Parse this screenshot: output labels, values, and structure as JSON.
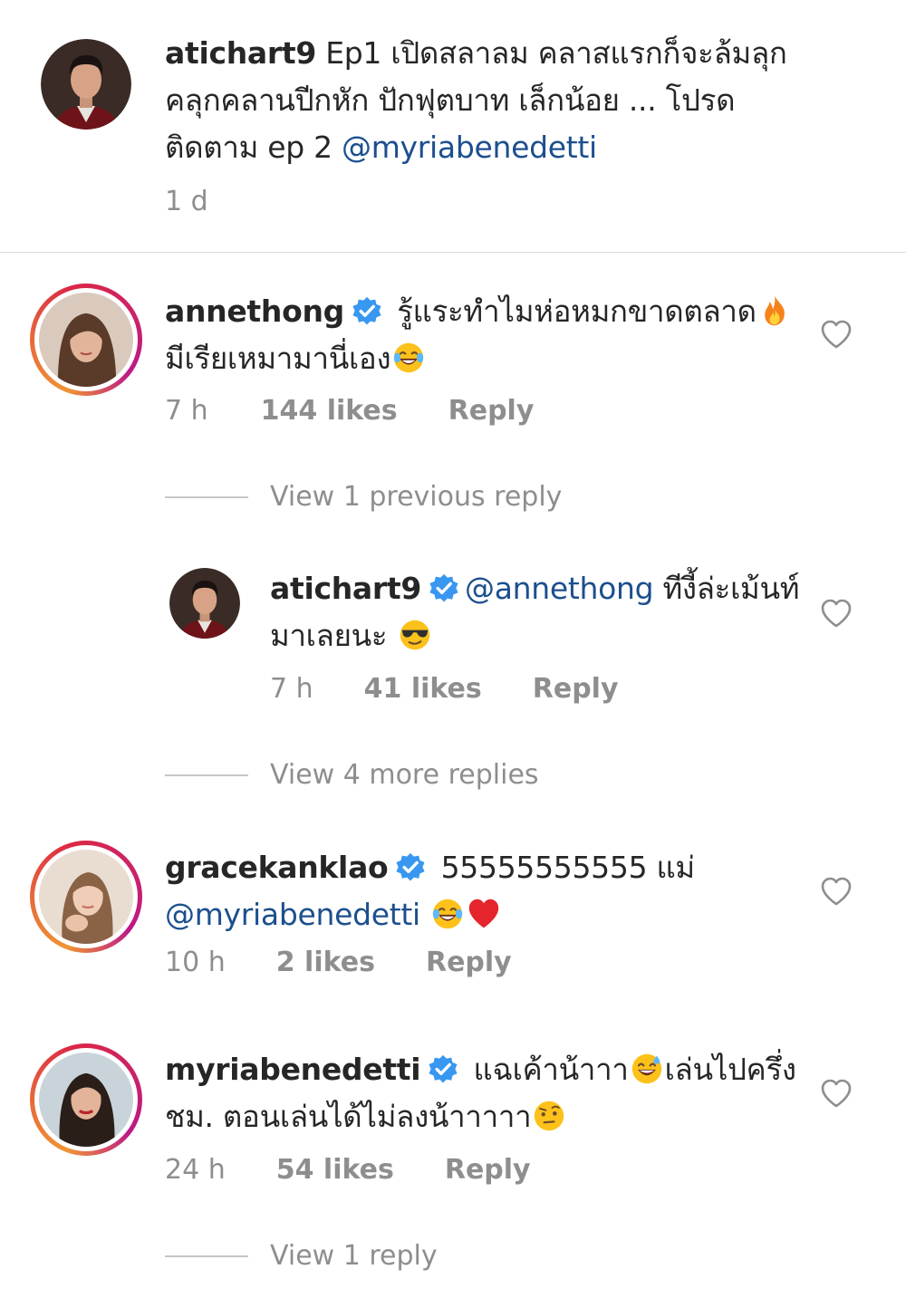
{
  "caption": {
    "username": "atichart9",
    "text_1": " Ep1 เปิดสลาลม คลาสแรกก็จะล้มลุกคลุกคลานปีกหัก ปักฟุตบาท เล็กน้อย ... โปรดติดตาม ep 2 ",
    "mention": "@myriabenedetti",
    "time": "1 d"
  },
  "comments": [
    {
      "username": "annethong",
      "text_1": " รู้แระทำไมห่อหมกขาดตลาด",
      "text_2": " มีเรียเหมามานี่เอง",
      "time": "7 h",
      "likes": "144 likes",
      "reply": "Reply",
      "emojis": [
        "fire-emoji",
        "tears-of-joy-emoji"
      ]
    },
    {
      "username": "atichart9",
      "mention": "@annethong",
      "text_1": " ทีงี้ล่ะเม้นท์มาเลยนะ ",
      "time": "7 h",
      "likes": "41 likes",
      "reply": "Reply",
      "emojis": [
        "sunglasses-emoji"
      ]
    },
    {
      "username": "gracekanklao",
      "text_1": " 55555555555 แม่ ",
      "mention": "@myriabenedetti",
      "time": "10 h",
      "likes": "2 likes",
      "reply": "Reply",
      "emojis": [
        "tears-of-joy-emoji",
        "red-heart-emoji"
      ]
    },
    {
      "username": "myriabenedetti",
      "text_1": " แฉเค้าน้าาา",
      "text_2": "เล่นไปครึ่งชม. ตอนเล่นได้ไม่ลงน้าาาาา",
      "time": "24 h",
      "likes": "54 likes",
      "reply": "Reply",
      "emojis": [
        "sweat-smile-emoji",
        "raised-eyebrow-emoji"
      ]
    }
  ],
  "view_links": {
    "previous": "View 1 previous reply",
    "more": "View 4 more replies",
    "one": "View 1 reply"
  },
  "colors": {
    "text": "#262626",
    "muted": "#8e8e8e",
    "mention": "#1c4f8e",
    "verified": "#3897f0"
  }
}
